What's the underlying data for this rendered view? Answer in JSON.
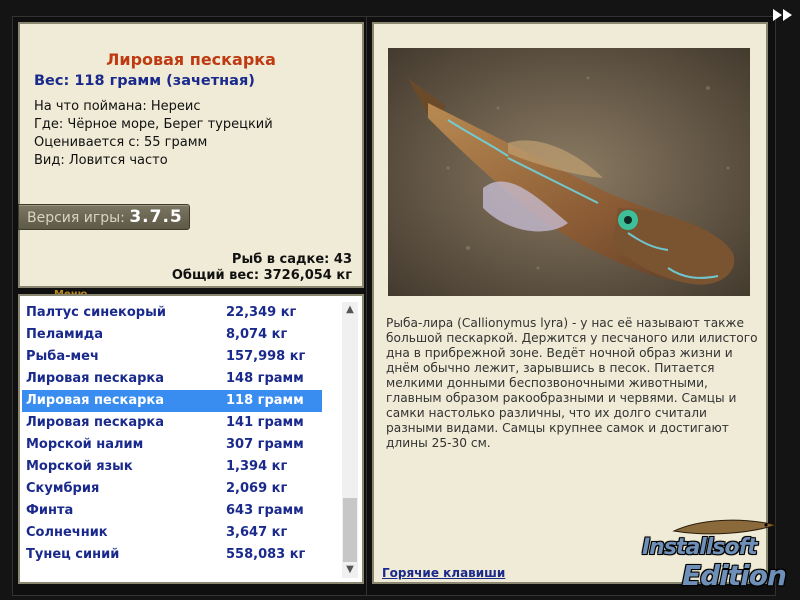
{
  "info": {
    "fish_name": "Лировая пескарка",
    "weight_line": "Вес: 118 грамм (зачетная)",
    "facts": [
      "На что поймана: Нереис",
      "Где: Чёрное море, Берег турецкий",
      "Оценивается с: 55 грамм",
      "Вид: Ловится часто"
    ],
    "version_label": "Версия игры:",
    "version_value": "3.7.5",
    "menu_label": "Меню",
    "fish_in_keepnet": "Рыб в садке: 43",
    "total_weight": "Общий вес: 3726,054 кг"
  },
  "catch_list": [
    {
      "name": "Палтус синекорый",
      "weight": "22,349 кг"
    },
    {
      "name": "Пеламида",
      "weight": "8,074 кг"
    },
    {
      "name": "Рыба-меч",
      "weight": "157,998 кг"
    },
    {
      "name": "Лировая пескарка",
      "weight": "148 грамм"
    },
    {
      "name": "Лировая пескарка",
      "weight": "118 грамм"
    },
    {
      "name": "Лировая пескарка",
      "weight": "141 грамм"
    },
    {
      "name": "Морской налим",
      "weight": "307 грамм"
    },
    {
      "name": "Морской язык",
      "weight": "1,394 кг"
    },
    {
      "name": "Скумбрия",
      "weight": "2,069 кг"
    },
    {
      "name": "Финта",
      "weight": "643 грамм"
    },
    {
      "name": "Солнечник",
      "weight": "3,647 кг"
    },
    {
      "name": "Тунец синий",
      "weight": "558,083 кг"
    }
  ],
  "selected_index": 4,
  "description": {
    "text": "Рыба-лира (Callionymus lyra) - у нас её называют также большой пескаркой. Держится у песчаного или илистого дна в прибрежной зоне. Ведёт ночной образ жизни и днём обычно лежит, зарывшись в песок. Питается мелкими донными беспозвоночными животными, главным образом ракообразными и червями. Самцы и самки настолько различны, что их долго считали разными видами. Самцы крупнее самок и достигают длины 25-30 см.",
    "hotkeys_link": "Горячие клавиши"
  },
  "watermark": {
    "line1": "Installsoft",
    "line2": "Edition"
  },
  "colors": {
    "accent_blue": "#1a2a8c",
    "title_red": "#bf3a10",
    "selection": "#3a8df0",
    "panel_bg": "#efebd6"
  },
  "icons": {
    "forward": "fast-forward-icon",
    "scroll_up": "chevron-up-icon",
    "scroll_down": "chevron-down-icon"
  }
}
